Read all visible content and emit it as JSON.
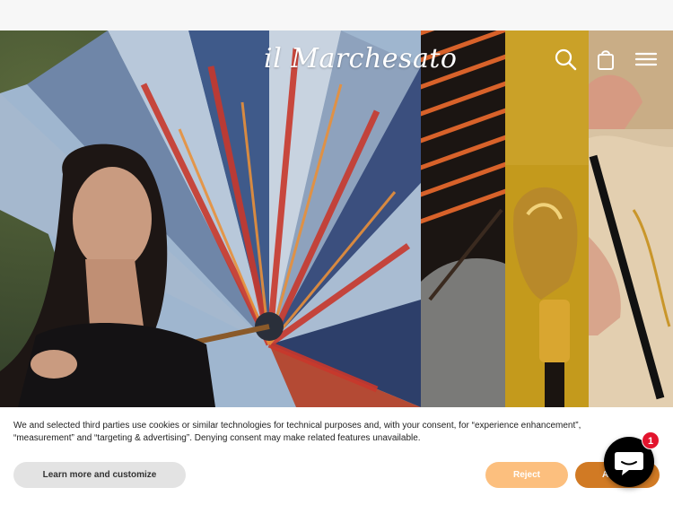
{
  "header": {
    "logo_text": "il Marchesato",
    "icons": [
      "search-icon",
      "bag-icon",
      "menu-icon"
    ]
  },
  "hero": {
    "panels": [
      "umbrella-woman-photo",
      "striped-umbrella-photo",
      "gold-horse-handle-photo",
      "black-cane-hand-photo"
    ]
  },
  "cookie_banner": {
    "text": "We and selected third parties use cookies or similar technologies for technical purposes and, with your consent, for “experience enhancement”, “measurement” and “targeting & advertising”. Denying consent may make related features unavailable.",
    "learn_label": "Learn more and customize",
    "reject_label": "Reject",
    "accept_label": "Ac"
  },
  "chat": {
    "badge_count": "1"
  },
  "colors": {
    "accept": "#d17a24",
    "reject": "#fcbf7e",
    "learn": "#e3e3e3",
    "badge": "#e2142d"
  }
}
